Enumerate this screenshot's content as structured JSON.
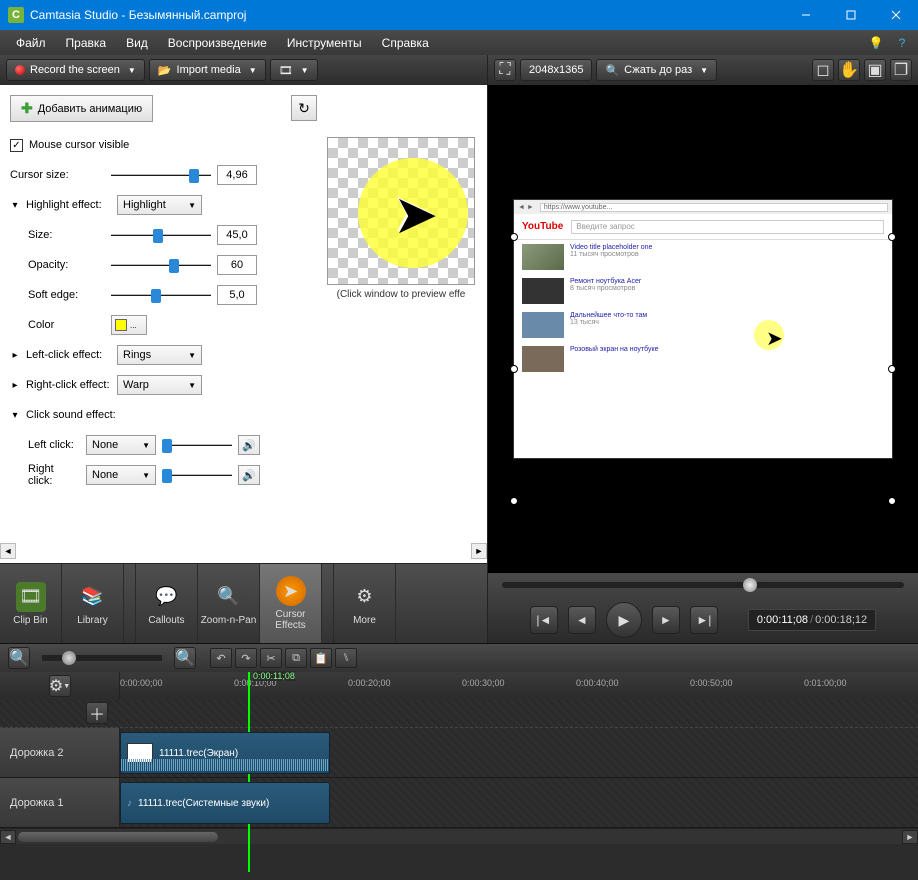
{
  "titlebar": {
    "app": "Camtasia Studio",
    "doc": "Безымянный.camproj"
  },
  "menu": {
    "file": "Файл",
    "edit": "Правка",
    "view": "Вид",
    "play": "Воспроизведение",
    "tools": "Инструменты",
    "help": "Справка"
  },
  "toolbar": {
    "record": "Record the screen",
    "import": "Import media"
  },
  "preview_toolbar": {
    "dims": "2048x1365",
    "shrink": "Сжать до раз"
  },
  "cursor_panel": {
    "add_anim": "Добавить анимацию",
    "mouse_visible": "Mouse cursor visible",
    "cursor_size_label": "Cursor size:",
    "cursor_size": "4,96",
    "highlight_effect_label": "Highlight effect:",
    "highlight_effect": "Highlight",
    "size_label": "Size:",
    "size": "45,0",
    "opacity_label": "Opacity:",
    "opacity": "60",
    "soft_edge_label": "Soft edge:",
    "soft_edge": "5,0",
    "color_label": "Color",
    "left_click_effect_label": "Left-click effect:",
    "left_click_effect": "Rings",
    "right_click_effect_label": "Right-click effect:",
    "right_click_effect": "Warp",
    "click_sound_label": "Click sound effect:",
    "left_click_label": "Left click:",
    "left_click": "None",
    "right_click_label": "Right click:",
    "right_click": "None",
    "preview_caption": "(Click window to preview effe"
  },
  "tabs": {
    "clipbin": "Clip Bin",
    "library": "Library",
    "callouts": "Callouts",
    "zoom": "Zoom-n-Pan",
    "cursor": "Cursor Effects",
    "more": "More"
  },
  "playback": {
    "current": "0:00:11;08",
    "total": "0:00:18;12"
  },
  "timeline": {
    "playhead": "0:00:11;08",
    "ticks": [
      "0:00:00;00",
      "0:00:10;00",
      "0:00:20;00",
      "0:00:30;00",
      "0:00:40;00",
      "0:00:50;00",
      "0:01:00;00"
    ],
    "track2_label": "Дорожка 2",
    "track1_label": "Дорожка 1",
    "clip2": "11111.trec(Экран)",
    "clip1": "11111.trec(Системные звуки)"
  },
  "yt": {
    "logo": "YouTube",
    "search_ph": "Введите запрос"
  }
}
